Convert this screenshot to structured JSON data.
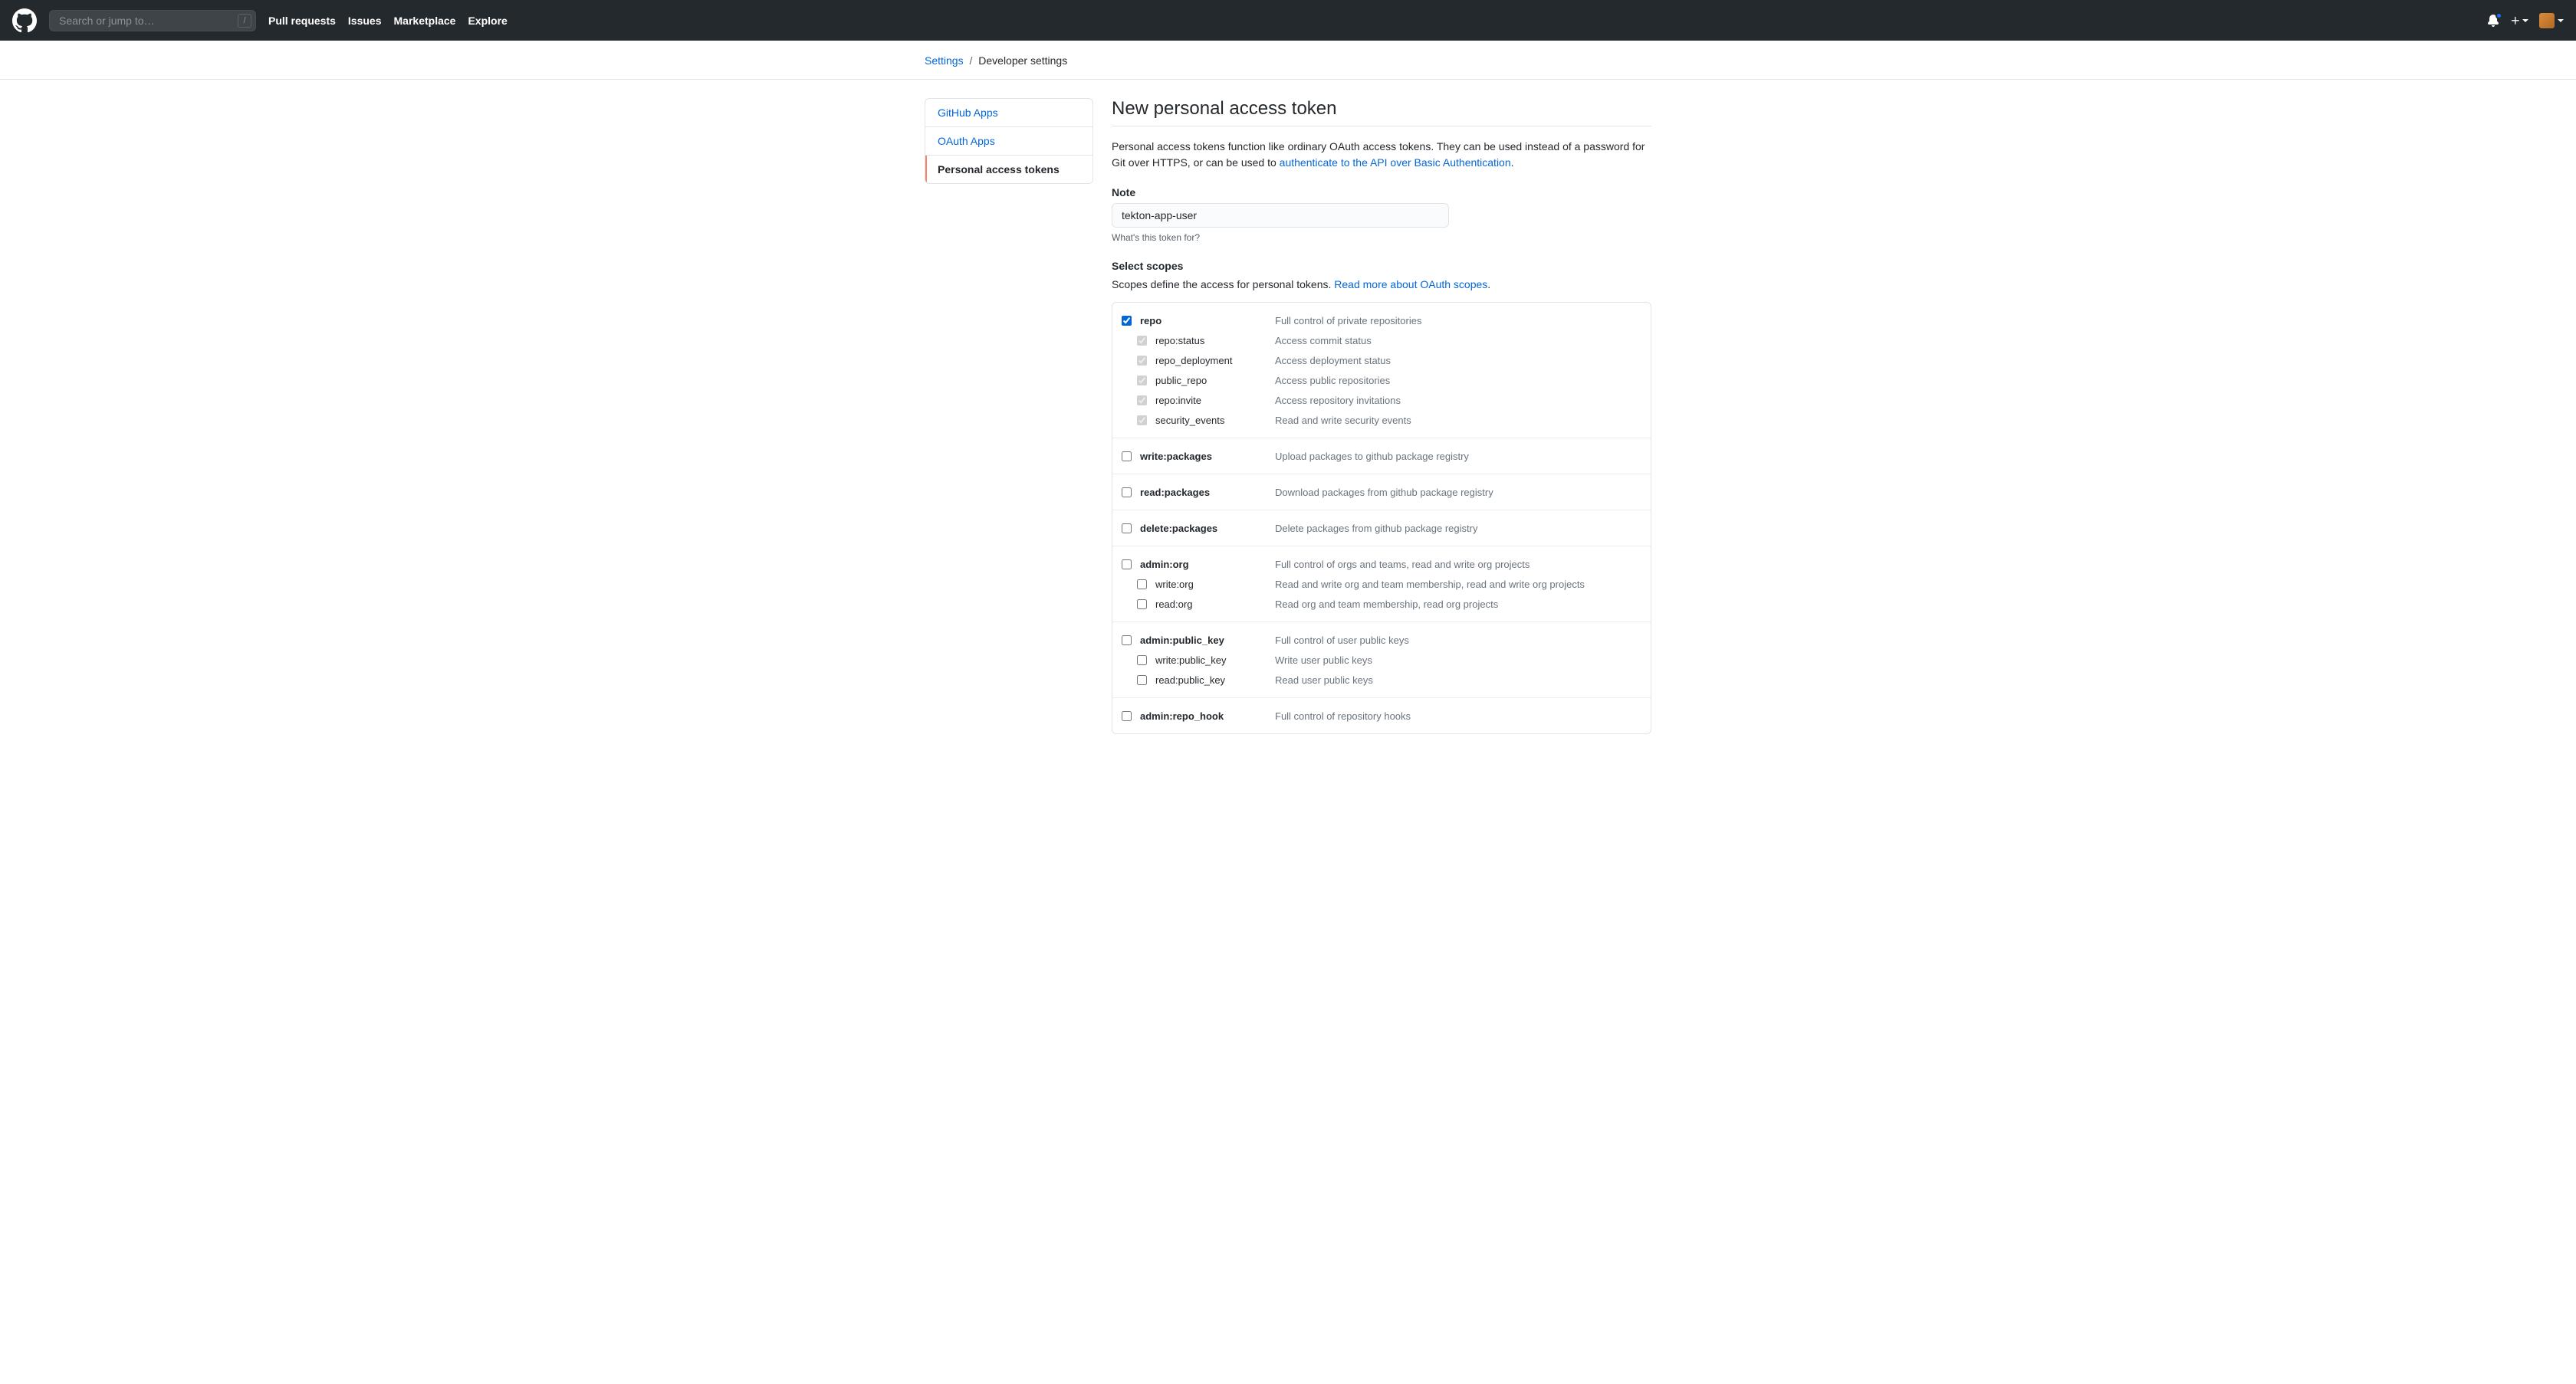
{
  "header": {
    "search_placeholder": "Search or jump to…",
    "slash": "/",
    "nav": {
      "pull_requests": "Pull requests",
      "issues": "Issues",
      "marketplace": "Marketplace",
      "explore": "Explore"
    }
  },
  "breadcrumb": {
    "settings": "Settings",
    "sep": "/",
    "current": "Developer settings"
  },
  "sidebar": {
    "items": [
      {
        "label": "GitHub Apps"
      },
      {
        "label": "OAuth Apps"
      },
      {
        "label": "Personal access tokens"
      }
    ]
  },
  "main": {
    "title": "New personal access token",
    "intro_part1": "Personal access tokens function like ordinary OAuth access tokens. They can be used instead of a password for Git over HTTPS, or can be used to ",
    "intro_link": "authenticate to the API over Basic Authentication",
    "intro_end": ".",
    "note_label": "Note",
    "note_value": "tekton-app-user",
    "note_help": "What's this token for?",
    "scopes_label": "Select scopes",
    "scopes_intro_text": "Scopes define the access for personal tokens. ",
    "scopes_intro_link": "Read more about OAuth scopes",
    "scopes_intro_end": "."
  },
  "scopes": [
    {
      "key": "repo",
      "name": "repo",
      "desc": "Full control of private repositories",
      "checked": true,
      "children": [
        {
          "name": "repo:status",
          "desc": "Access commit status",
          "checked": true,
          "disabled": true
        },
        {
          "name": "repo_deployment",
          "desc": "Access deployment status",
          "checked": true,
          "disabled": true
        },
        {
          "name": "public_repo",
          "desc": "Access public repositories",
          "checked": true,
          "disabled": true
        },
        {
          "name": "repo:invite",
          "desc": "Access repository invitations",
          "checked": true,
          "disabled": true
        },
        {
          "name": "security_events",
          "desc": "Read and write security events",
          "checked": true,
          "disabled": true
        }
      ]
    },
    {
      "key": "write_packages",
      "name": "write:packages",
      "desc": "Upload packages to github package registry",
      "checked": false,
      "children": []
    },
    {
      "key": "read_packages",
      "name": "read:packages",
      "desc": "Download packages from github package registry",
      "checked": false,
      "children": []
    },
    {
      "key": "delete_packages",
      "name": "delete:packages",
      "desc": "Delete packages from github package registry",
      "checked": false,
      "children": []
    },
    {
      "key": "admin_org",
      "name": "admin:org",
      "desc": "Full control of orgs and teams, read and write org projects",
      "checked": false,
      "children": [
        {
          "name": "write:org",
          "desc": "Read and write org and team membership, read and write org projects",
          "checked": false,
          "disabled": false
        },
        {
          "name": "read:org",
          "desc": "Read org and team membership, read org projects",
          "checked": false,
          "disabled": false
        }
      ]
    },
    {
      "key": "admin_public_key",
      "name": "admin:public_key",
      "desc": "Full control of user public keys",
      "checked": false,
      "children": [
        {
          "name": "write:public_key",
          "desc": "Write user public keys",
          "checked": false,
          "disabled": false
        },
        {
          "name": "read:public_key",
          "desc": "Read user public keys",
          "checked": false,
          "disabled": false
        }
      ]
    },
    {
      "key": "admin_repo_hook",
      "name": "admin:repo_hook",
      "desc": "Full control of repository hooks",
      "checked": false,
      "children": []
    }
  ]
}
